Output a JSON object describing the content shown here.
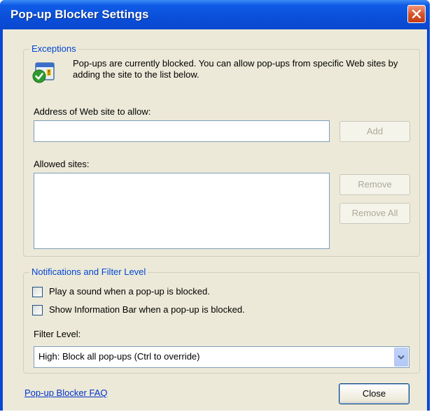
{
  "window": {
    "title": "Pop-up Blocker Settings",
    "close_icon": "close-x-icon"
  },
  "exceptions": {
    "legend": "Exceptions",
    "info_icon": "shield-checkmark-icon",
    "info_text": "Pop-ups are currently blocked.  You can allow pop-ups from specific Web sites by adding the site to the list below.",
    "address_label": "Address of Web site to allow:",
    "address_value": "",
    "add_label": "Add",
    "allowed_label": "Allowed sites:",
    "allowed_sites": [],
    "remove_label": "Remove",
    "remove_all_label": "Remove All"
  },
  "notifications": {
    "legend": "Notifications and Filter Level",
    "play_sound_label": "Play a sound when a pop-up is blocked.",
    "play_sound_checked": false,
    "show_info_bar_label": "Show Information Bar when a pop-up is blocked.",
    "show_info_bar_checked": false,
    "filter_level_label": "Filter Level:",
    "filter_level_value": "High: Block all pop-ups (Ctrl to override)"
  },
  "footer": {
    "faq_link": "Pop-up Blocker FAQ",
    "close_label": "Close"
  },
  "colors": {
    "titlebar": "#0a4fd9",
    "dialog_background": "#ece9d8",
    "group_legend": "#0046d5",
    "link": "#0033cc",
    "close_button": "#d8532a"
  }
}
